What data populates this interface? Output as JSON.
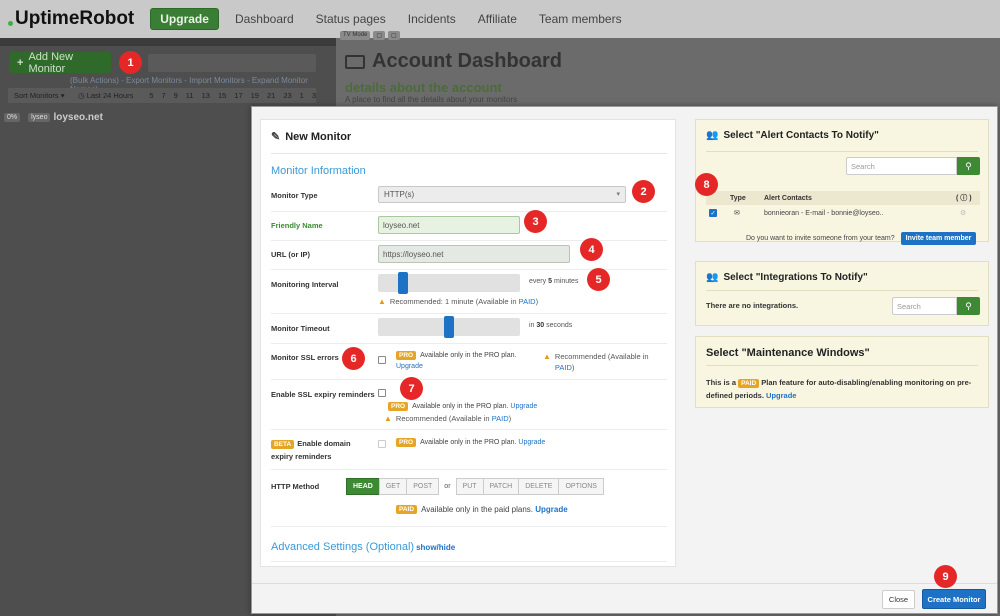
{
  "topnav": {
    "logo": "UptimeRobot",
    "upgrade": "Upgrade",
    "links": [
      "Dashboard",
      "Status pages",
      "Incidents",
      "Affiliate",
      "Team members"
    ]
  },
  "sidebar": {
    "add_monitor": "Add New Monitor",
    "bulk_links": "(Bulk Actions) - Export Monitors - Import Monitors - Expand Monitor Names)",
    "sort_label": "Sort Monitors",
    "last_label": "Last 24 Hours",
    "hours": [
      "5",
      "7",
      "9",
      "11",
      "13",
      "15",
      "17",
      "19",
      "21",
      "23",
      "1",
      "3"
    ],
    "monitor": {
      "pct": "0%",
      "tag": "lyseo",
      "name": "loyseo.net"
    }
  },
  "dashboard": {
    "tv_labels": [
      "TV Mode",
      "▢",
      "▢"
    ],
    "title": "Account Dashboard",
    "subtitle": "details about the account",
    "subtitle2": "A place to find all the details about your monitors"
  },
  "form": {
    "header": "New Monitor",
    "section": "Monitor Information",
    "monitor_type_label": "Monitor Type",
    "monitor_type_value": "HTTP(s)",
    "friendly_name_label": "Friendly Name",
    "friendly_name_value": "loyseo.net",
    "url_label": "URL (or IP)",
    "url_value": "https://loyseo.net",
    "interval_label": "Monitoring Interval",
    "interval_prefix": "every",
    "interval_value": "5",
    "interval_unit": "minutes",
    "interval_level": 0.15,
    "interval_recommend": "Recommended: 1 minute (Available in",
    "paid": "PAID",
    "timeout_label": "Monitor Timeout",
    "timeout_prefix": "in",
    "timeout_value": "30",
    "timeout_unit": "seconds",
    "timeout_level": 0.5,
    "ssl_errors_label": "Monitor SSL errors",
    "pro": "PRO",
    "pro_text": "Available only in the PRO plan.",
    "upgrade": "Upgrade",
    "recommended_available_in": "Recommended (Available in",
    "ssl_expiry_label": "Enable SSL expiry reminders",
    "beta": "BETA",
    "domain_expiry_label": "Enable domain expiry reminders",
    "http_method_label": "HTTP Method",
    "methods_a": [
      "HEAD",
      "GET",
      "POST"
    ],
    "or": "or",
    "methods_b": [
      "PUT",
      "PATCH",
      "DELETE",
      "OPTIONS"
    ],
    "paid_plans_text": "Available only in the paid plans.",
    "advanced": "Advanced Settings (Optional)",
    "show_hide": "show/hide"
  },
  "alert_contacts": {
    "title": "Select \"Alert Contacts To Notify\"",
    "search_placeholder": "Search",
    "col_type": "Type",
    "col_contacts": "Alert Contacts",
    "col_info": "( ⓘ )",
    "contact": "bonnieoran - E-mail - bonnie@loyseo..",
    "invite_question": "Do you want to invite someone from your team?",
    "invite_button": "Invite team member"
  },
  "integrations": {
    "title": "Select \"Integrations To Notify\"",
    "empty": "There are no integrations.",
    "search_placeholder": "Search"
  },
  "maintenance": {
    "title": "Select \"Maintenance Windows\"",
    "text_a": "This is a",
    "paid": "PAID",
    "text_b": "Plan feature for auto-disabling/enabling monitoring on pre-defined periods.",
    "upgrade": "Upgrade"
  },
  "footer": {
    "close": "Close",
    "create": "Create Monitor"
  },
  "callouts": [
    "1",
    "2",
    "3",
    "4",
    "5",
    "6",
    "7",
    "8",
    "9"
  ],
  "colors": {
    "accent_green": "#3e8a34",
    "primary_blue": "#1d72c6",
    "badge_orange": "#e6a526",
    "callout_red": "#e52727"
  }
}
